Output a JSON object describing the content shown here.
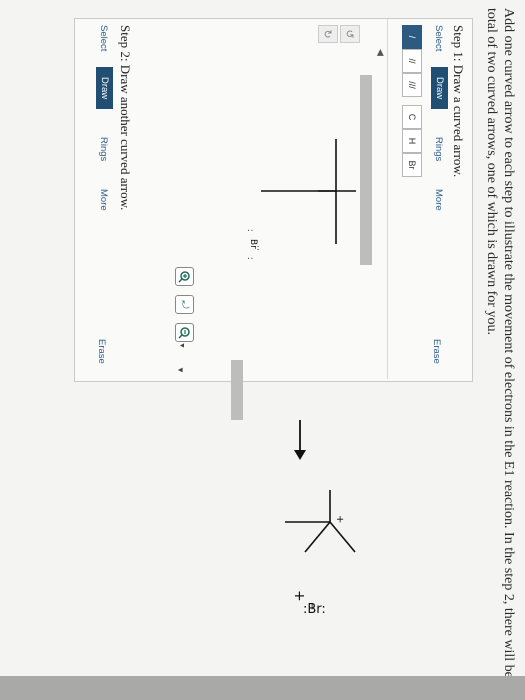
{
  "instruction_text": "Add one curved arrow to each step to illustrate the movement of electrons in the E1 reaction. In the step 2, there will be a total of two curved arrows, one of which is drawn for you.",
  "step1": {
    "title": "Step 1: Draw a curved arrow.",
    "tabs": {
      "select": "Select",
      "draw": "Draw",
      "rings": "Rings",
      "more": "More",
      "erase": "Erase"
    },
    "tools": {
      "single_bond": "/",
      "double_bond": "//",
      "triple_bond": "///",
      "carbon": "C",
      "hydrogen": "H",
      "bromine": "Br"
    },
    "molecule_br_label": "Br"
  },
  "step2": {
    "title": "Step 2: Draw another curved arrow.",
    "tabs": {
      "select": "Select",
      "draw": "Draw",
      "rings": "Rings",
      "more": "More",
      "erase": "Erase"
    }
  },
  "product": {
    "plus_label": "+",
    "bromide_label": ":Br:",
    "charge_plus": "+",
    "charge_minus": "−"
  },
  "colors": {
    "draw_tab": "#214f73",
    "link": "#2f5e8a"
  }
}
